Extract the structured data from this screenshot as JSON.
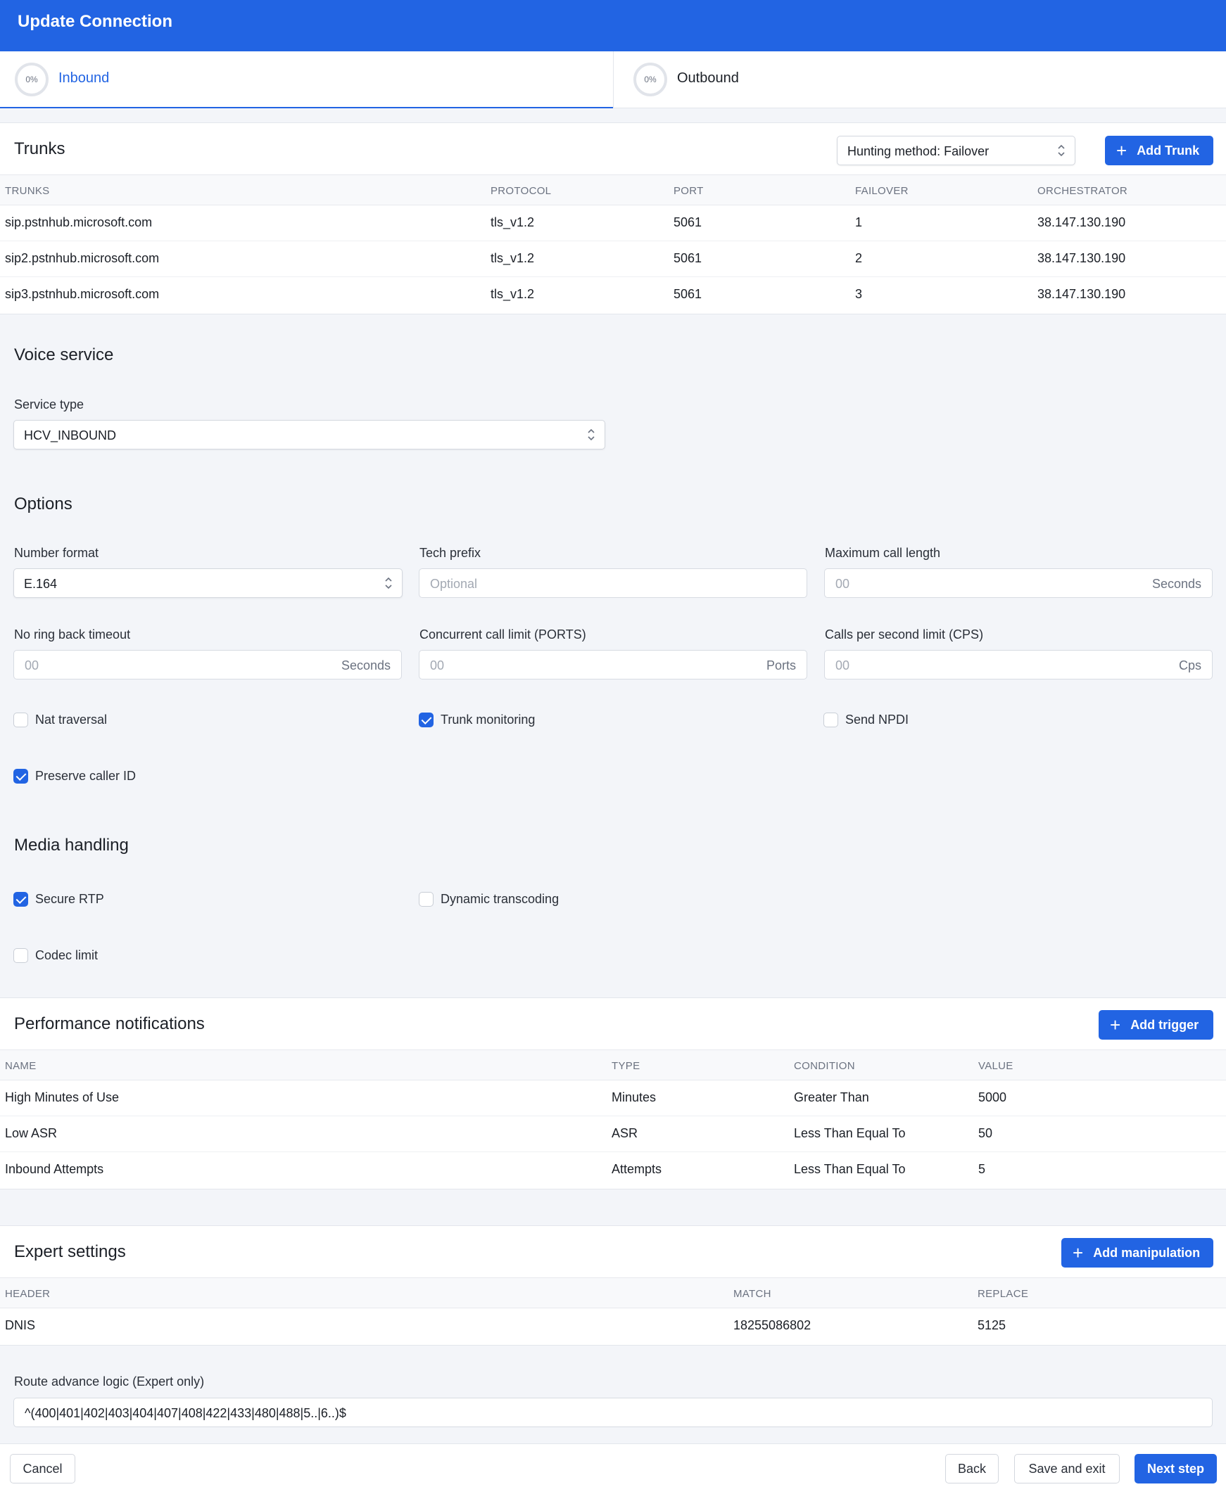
{
  "header": {
    "title": "Update Connection"
  },
  "tabs": [
    {
      "label": "Inbound",
      "progress": "0%",
      "active": true
    },
    {
      "label": "Outbound",
      "progress": "0%",
      "active": false
    }
  ],
  "trunks": {
    "title": "Trunks",
    "hunting_method": "Hunting method: Failover",
    "add_label": "Add Trunk",
    "columns": [
      "TRUNKS",
      "PROTOCOL",
      "PORT",
      "FAILOVER",
      "ORCHESTRATOR"
    ],
    "rows": [
      [
        "sip.pstnhub.microsoft.com",
        "tls_v1.2",
        "5061",
        "1",
        "38.147.130.190"
      ],
      [
        "sip2.pstnhub.microsoft.com",
        "tls_v1.2",
        "5061",
        "2",
        "38.147.130.190"
      ],
      [
        "sip3.pstnhub.microsoft.com",
        "tls_v1.2",
        "5061",
        "3",
        "38.147.130.190"
      ]
    ]
  },
  "voice_service": {
    "title": "Voice service",
    "service_type_label": "Service type",
    "service_type_value": "HCV_INBOUND"
  },
  "options": {
    "title": "Options",
    "number_format_label": "Number format",
    "number_format_value": "E.164",
    "tech_prefix_label": "Tech prefix",
    "tech_prefix_placeholder": "Optional",
    "max_call_label": "Maximum call length",
    "max_call_placeholder": "00",
    "max_call_suffix": "Seconds",
    "no_ring_label": "No ring back timeout",
    "no_ring_placeholder": "00",
    "no_ring_suffix": "Seconds",
    "concurrent_label": "Concurrent call limit (PORTS)",
    "concurrent_placeholder": "00",
    "concurrent_suffix": "Ports",
    "cps_label": "Calls per second limit (CPS)",
    "cps_placeholder": "00",
    "cps_suffix": "Cps",
    "nat_traversal": {
      "label": "Nat traversal",
      "checked": false
    },
    "trunk_monitoring": {
      "label": "Trunk monitoring",
      "checked": true
    },
    "send_npdi": {
      "label": "Send NPDI",
      "checked": false
    },
    "preserve_caller_id": {
      "label": "Preserve caller ID",
      "checked": true
    }
  },
  "media": {
    "title": "Media handling",
    "secure_rtp": {
      "label": "Secure RTP",
      "checked": true
    },
    "dynamic_transcoding": {
      "label": "Dynamic transcoding",
      "checked": false
    },
    "codec_limit": {
      "label": "Codec limit",
      "checked": false
    }
  },
  "performance": {
    "title": "Performance notifications",
    "add_label": "Add trigger",
    "columns": [
      "NAME",
      "TYPE",
      "CONDITION",
      "VALUE"
    ],
    "rows": [
      [
        "High Minutes of Use",
        "Minutes",
        "Greater Than",
        "5000"
      ],
      [
        "Low ASR",
        "ASR",
        "Less Than Equal To",
        "50"
      ],
      [
        "Inbound Attempts",
        "Attempts",
        "Less Than Equal To",
        "5"
      ]
    ]
  },
  "expert": {
    "title": "Expert settings",
    "add_label": "Add manipulation",
    "columns": [
      "HEADER",
      "MATCH",
      "REPLACE"
    ],
    "rows": [
      [
        "DNIS",
        "18255086802",
        "5125"
      ]
    ],
    "route_label": "Route advance logic (Expert only)",
    "route_value": "^(400|401|402|403|404|407|408|422|433|480|488|5..|6..)$"
  },
  "footer": {
    "cancel": "Cancel",
    "back": "Back",
    "save_exit": "Save and exit",
    "next": "Next step"
  },
  "colors": {
    "primary": "#2264e3",
    "background": "#f3f5f9"
  }
}
